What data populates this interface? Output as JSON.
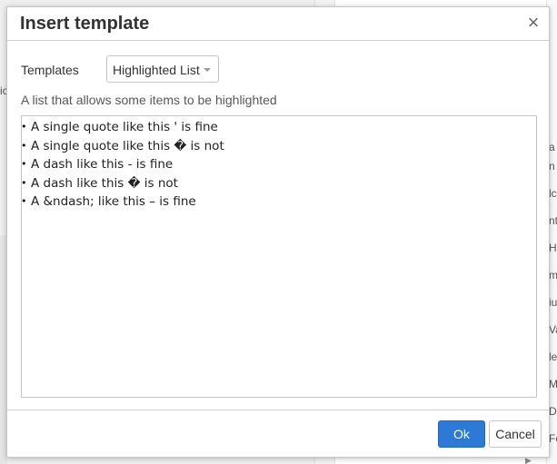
{
  "background": {
    "right_fragments": [
      "a",
      "n",
      "lc",
      "nt",
      "Hi",
      "m",
      "iu",
      "Va",
      "le",
      "Ma",
      "Du",
      "Fo"
    ],
    "left_fragment": "ic"
  },
  "dialog": {
    "title": "Insert template",
    "close_symbol": "×",
    "templates_label": "Templates",
    "selected_template": "Highlighted List",
    "description": "A list that allows some items to be highlighted",
    "preview_items": [
      "A single quote like this ' is fine",
      "A single quote like this � is not",
      "A dash like this - is fine",
      "A dash like this � is not",
      "A &ndash; like this – is fine"
    ],
    "ok_label": "Ok",
    "cancel_label": "Cancel"
  }
}
